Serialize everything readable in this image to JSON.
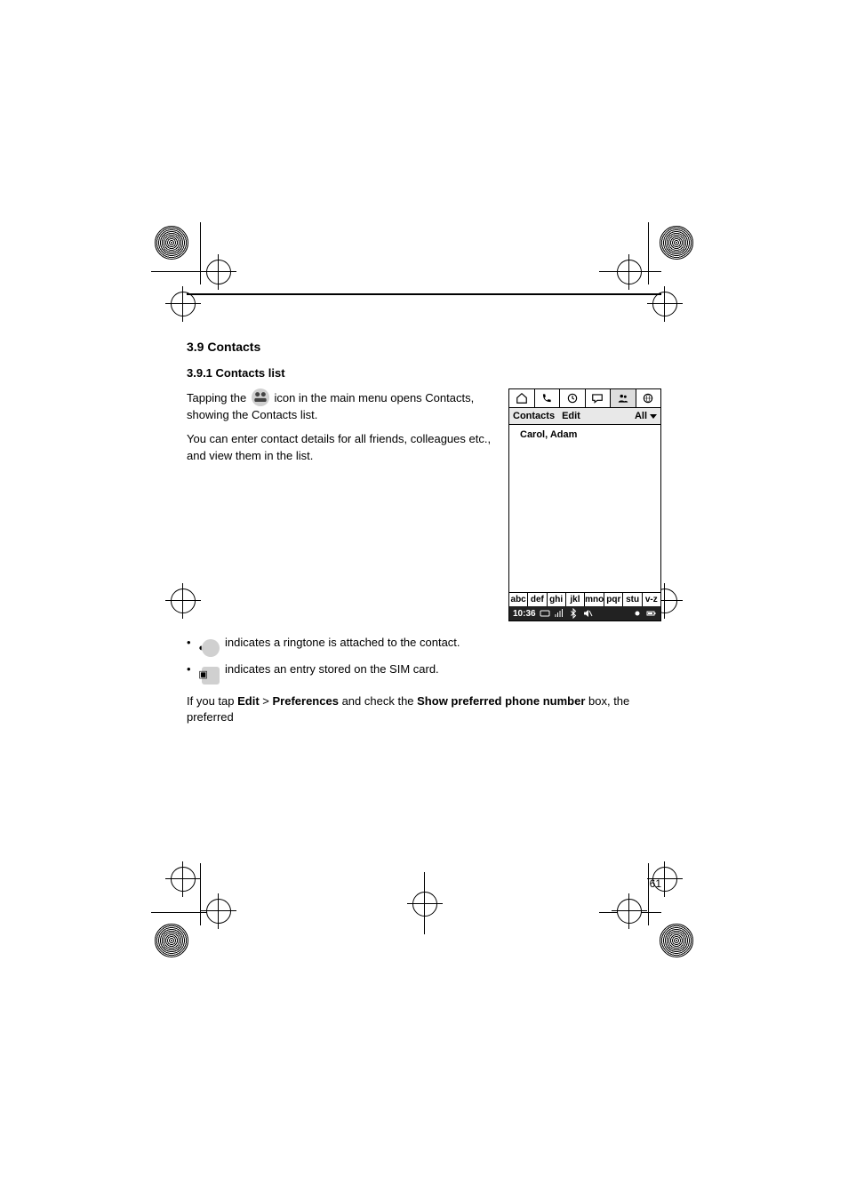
{
  "section": {
    "title": "3.9 Contacts",
    "subtitle": "3.9.1 Contacts list"
  },
  "intro": {
    "line1_pre": "Tapping the ",
    "line1_post": " icon in the main menu opens Contacts, showing the Contacts list.",
    "line2": "You can enter contact details for all friends, colleagues etc., and view them in the list."
  },
  "bullets": [
    {
      "icon_name": "ring-icon",
      "icon_text": "◐",
      "text": " indicates a ringtone is attached to the contact."
    },
    {
      "icon_name": "sim-card-icon",
      "icon_text": "▣",
      "text": " indicates an entry stored on the SIM card."
    }
  ],
  "preferences_line": {
    "pre": "If you tap ",
    "menu1": "Edit",
    "mid1": " > ",
    "menu2": "Preferences",
    "mid2": " and check the ",
    "opt": "Show preferred phone number",
    "post": " box, the preferred"
  },
  "phone": {
    "tabs": [
      "home",
      "phone",
      "clock",
      "message",
      "contacts",
      "browser"
    ],
    "menu": {
      "contacts_label": "Contacts",
      "edit_label": "Edit",
      "filter_label": "All"
    },
    "list": [
      {
        "name": "Carol, Adam"
      }
    ],
    "keypad": [
      "abc",
      "def",
      "ghi",
      "jkl",
      "mno",
      "pqr",
      "stu",
      "v-z"
    ],
    "status": {
      "time": "10:36",
      "icons": [
        "signal",
        "bluetooth",
        "mute"
      ],
      "right_icons": [
        "record",
        "battery"
      ]
    }
  },
  "page_number": "61"
}
